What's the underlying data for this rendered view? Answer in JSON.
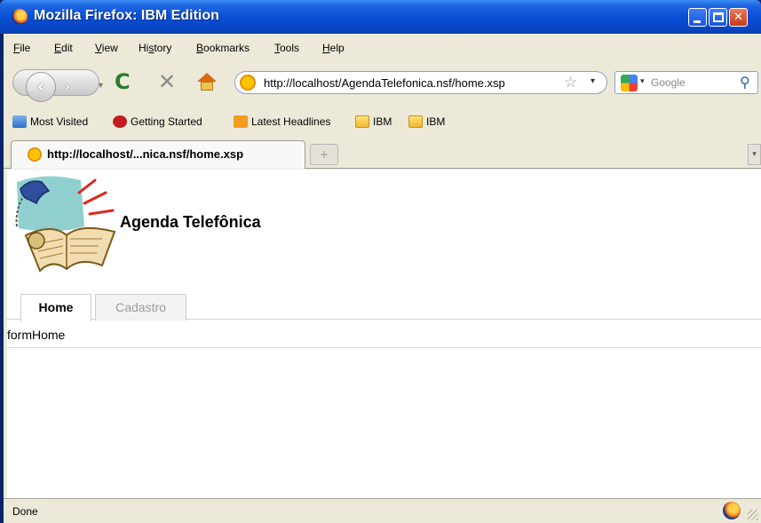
{
  "window": {
    "title": "Mozilla Firefox: IBM Edition",
    "minimize_icon": "minimize-icon",
    "maximize_icon": "maximize-icon",
    "close_icon": "close-icon",
    "close_glyph": "✕"
  },
  "menu": {
    "items": [
      {
        "label": "File",
        "access": "F",
        "rest": "ile"
      },
      {
        "label": "Edit",
        "access": "E",
        "rest": "dit"
      },
      {
        "label": "View",
        "access": "V",
        "rest": "iew"
      },
      {
        "label": "History",
        "pre": "Hi",
        "access": "s",
        "rest": "tory"
      },
      {
        "label": "Bookmarks",
        "access": "B",
        "rest": "ookmarks"
      },
      {
        "label": "Tools",
        "access": "T",
        "rest": "ools"
      },
      {
        "label": "Help",
        "access": "H",
        "rest": "elp"
      }
    ]
  },
  "nav": {
    "back_glyph": "‹",
    "forward_glyph": "›",
    "dropdown_glyph": "▾",
    "reload_glyph": "C",
    "stop_glyph": "✕",
    "url": "http://localhost/AgendaTelefonica.nsf/home.xsp",
    "star_glyph": "☆",
    "url_drop_glyph": "▾",
    "search_placeholder": "Google",
    "search_drop_glyph": "▾",
    "search_glyph": "⚲"
  },
  "bookmarks": {
    "items": [
      {
        "label": "Most Visited",
        "icon": "most-visited-icon"
      },
      {
        "label": "Getting Started",
        "icon": "getting-started-icon"
      },
      {
        "label": "Latest Headlines",
        "icon": "rss-icon"
      },
      {
        "label": "IBM",
        "icon": "folder-icon"
      },
      {
        "label": "IBM",
        "icon": "folder-icon"
      }
    ]
  },
  "tabs": {
    "active_title": "http://localhost/...nica.nsf/home.xsp",
    "new_tab_glyph": "+",
    "scroll_glyph": "▾"
  },
  "page": {
    "site_title": "Agenda Telefônica",
    "app_tabs": [
      {
        "label": "Home",
        "active": true
      },
      {
        "label": "Cadastro",
        "active": false
      }
    ],
    "form_label": "formHome"
  },
  "status": {
    "text": "Done"
  }
}
